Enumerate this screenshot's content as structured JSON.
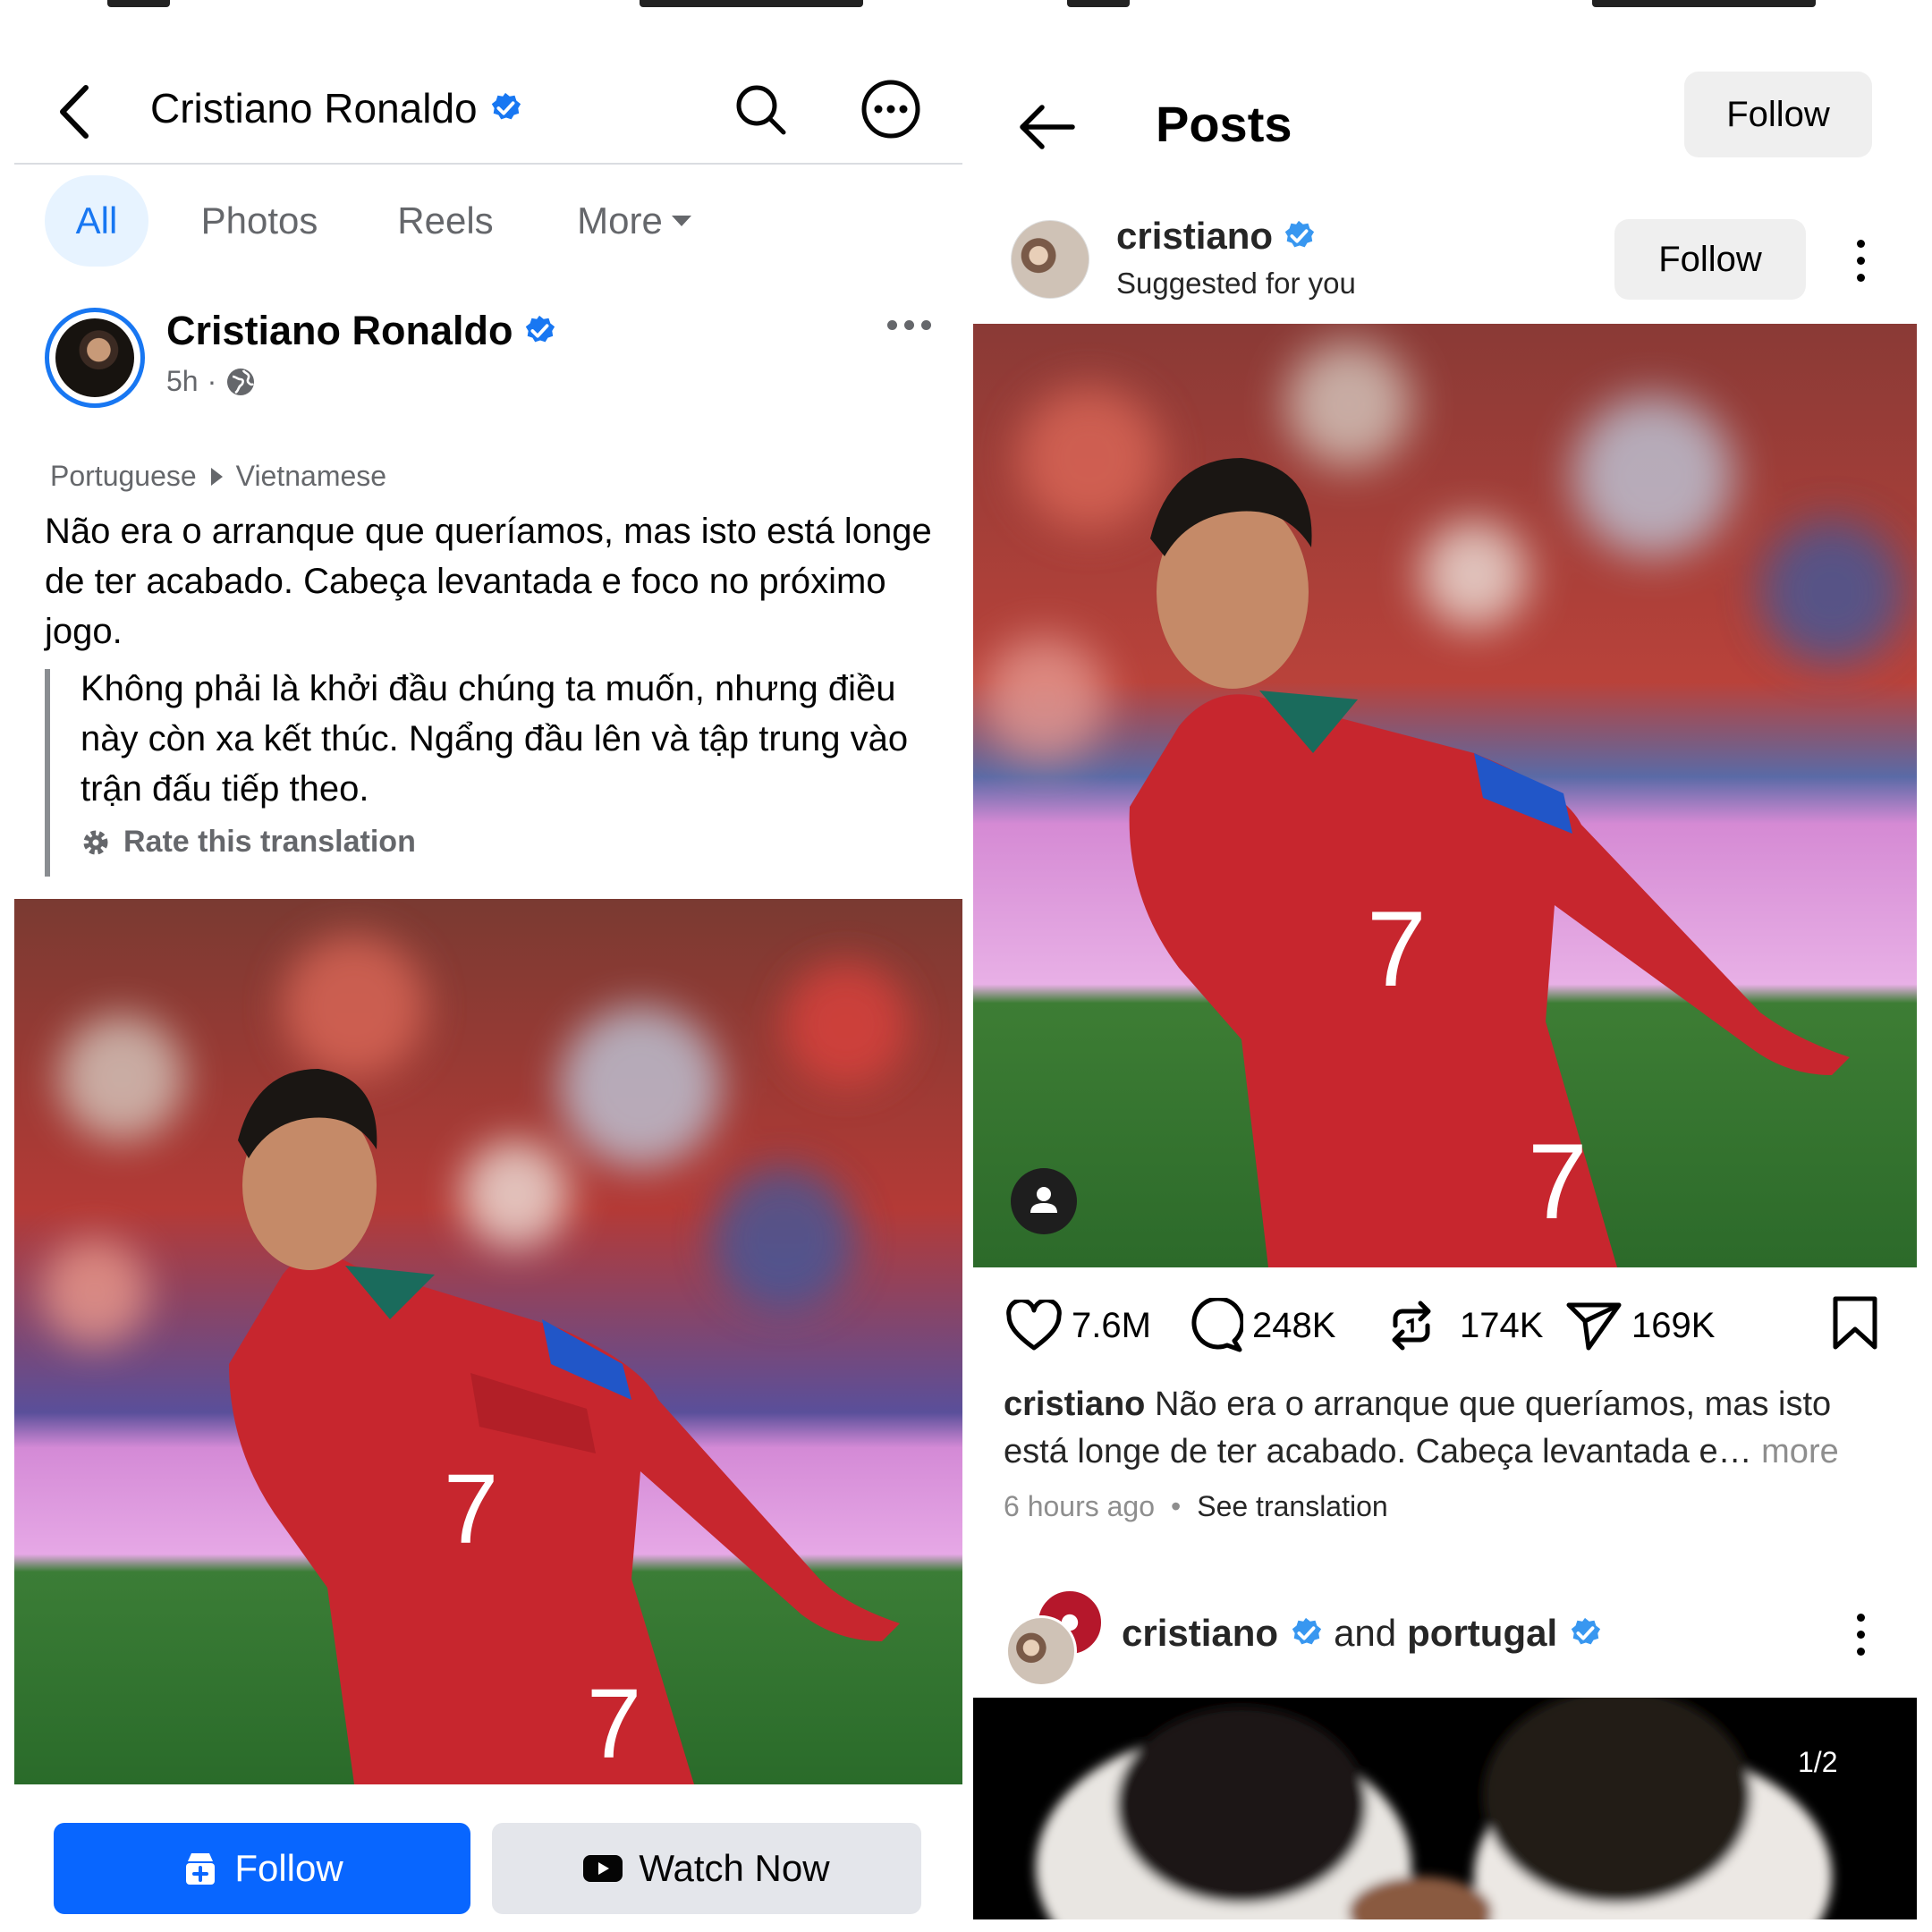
{
  "left": {
    "header": {
      "title": "Cristiano Ronaldo"
    },
    "tabs": [
      {
        "label": "All",
        "active": true
      },
      {
        "label": "Photos",
        "active": false
      },
      {
        "label": "Reels",
        "active": false
      },
      {
        "label": "More",
        "active": false
      }
    ],
    "post": {
      "author": "Cristiano Ronaldo",
      "time": "5h",
      "separator": "·",
      "lang_from": "Portuguese",
      "lang_to": "Vietnamese",
      "text": "Não era o arranque que queríamos, mas isto está longe de ter acabado. Cabeça levantada e foco no próximo jogo.",
      "translation": "Không phải là khởi đầu chúng ta muốn, nhưng điều này còn xa kết thúc. Ngẩng đầu lên và tập trung vào trận đấu tiếp theo.",
      "rate_label": "Rate this translation"
    },
    "buttons": {
      "follow": "Follow",
      "watch": "Watch Now"
    },
    "colors": {
      "accent": "#0866ff",
      "tab_active_bg": "#e7f3ff",
      "verified": "#1877f2"
    }
  },
  "right": {
    "header": {
      "title": "Posts",
      "follow": "Follow"
    },
    "post1": {
      "username": "cristiano",
      "subtitle": "Suggested for you",
      "follow": "Follow",
      "stats": {
        "likes": "7.6M",
        "comments": "248K",
        "reposts": "174K",
        "shares": "169K"
      },
      "caption_user": "cristiano",
      "caption_text": "Não era o arranque que queríamos, mas isto está longe de ter acabado. Cabeça levantada e…",
      "caption_more": "more",
      "time": "6 hours ago",
      "dot": "•",
      "see_translation": "See translation"
    },
    "post2": {
      "user1": "cristiano",
      "connector": "and",
      "user2": "portugal",
      "counter": "1/2"
    },
    "icons": [
      "back-arrow-icon",
      "heart-icon",
      "comment-icon",
      "repost-icon",
      "send-icon",
      "bookmark-icon",
      "person-tag-icon",
      "kebab-icon"
    ]
  }
}
